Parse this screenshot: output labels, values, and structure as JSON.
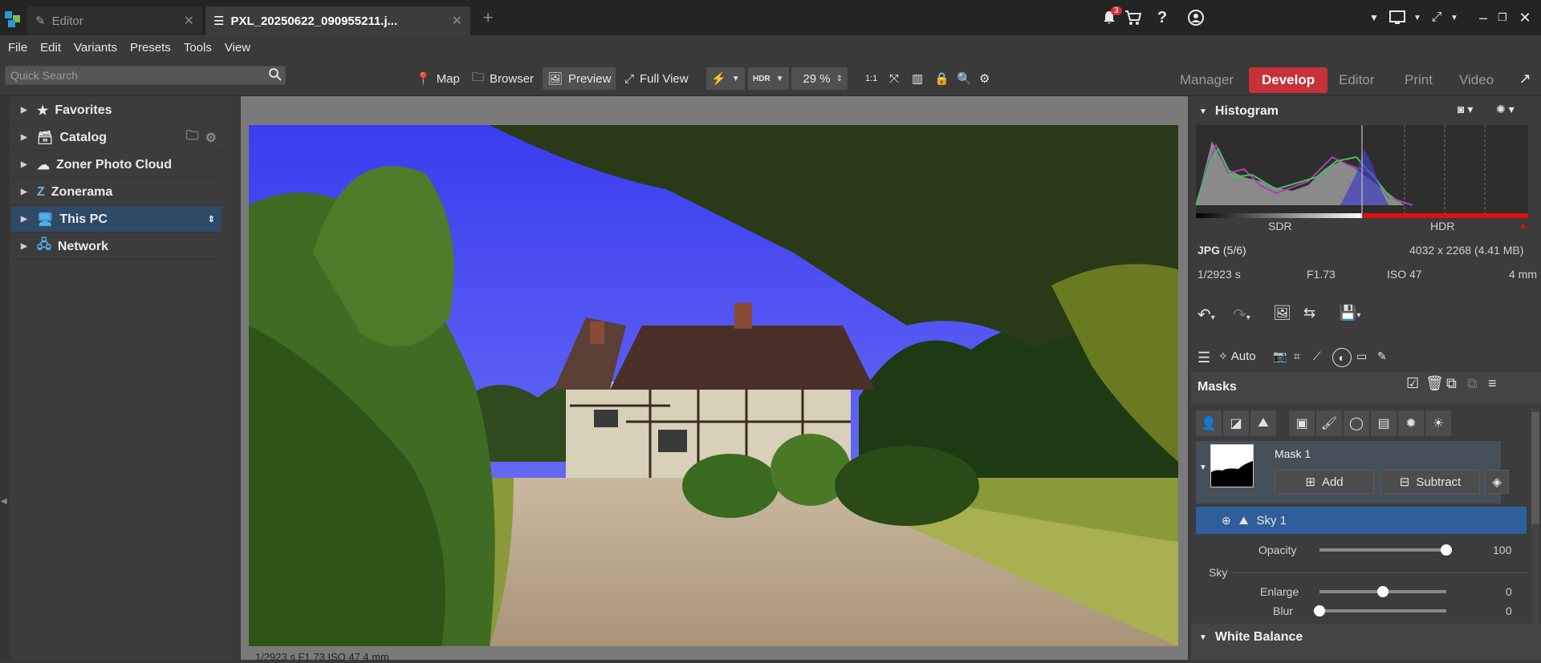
{
  "tabs": [
    {
      "label": "Editor",
      "active": false
    },
    {
      "label": "PXL_20250622_090955211.j...",
      "active": true
    }
  ],
  "notifications": {
    "count": "3"
  },
  "menu": [
    "File",
    "Edit",
    "Variants",
    "Presets",
    "Tools",
    "View"
  ],
  "search": {
    "placeholder": "Quick Search"
  },
  "toolbar": {
    "map": "Map",
    "browser": "Browser",
    "preview": "Preview",
    "fullview": "Full View",
    "hdr": "HDR",
    "zoom": "29 %"
  },
  "modes": [
    "Manager",
    "Develop",
    "Editor",
    "Print",
    "Video"
  ],
  "active_mode": "Develop",
  "nav": [
    {
      "label": "Favorites"
    },
    {
      "label": "Catalog"
    },
    {
      "label": "Zoner Photo Cloud"
    },
    {
      "label": "Zonerama"
    },
    {
      "label": "This PC"
    },
    {
      "label": "Network"
    }
  ],
  "photo_info_bottom": "1/2923 s   F1.73   ISO 47   4 mm",
  "histogram": {
    "title": "Histogram",
    "sdr": "SDR",
    "hdr": "HDR"
  },
  "file_info": {
    "format": "JPG",
    "index": "(5/6)",
    "dims": "4032 x 2268 (4.41 MB)",
    "shutter": "1/2923 s",
    "aperture": "F1.73",
    "iso": "ISO 47",
    "focal": "4 mm"
  },
  "auto_label": "Auto",
  "masks": {
    "title": "Masks",
    "mask_name": "Mask 1",
    "add": "Add",
    "subtract": "Subtract",
    "sky_item": "Sky 1",
    "opacity_label": "Opacity",
    "opacity_value": "100",
    "sky_section": "Sky",
    "enlarge_label": "Enlarge",
    "enlarge_value": "0",
    "blur_label": "Blur",
    "blur_value": "0"
  },
  "opacity_level": 1.0,
  "enlarge_level": 0.5,
  "blur_level": 0.0,
  "white_balance": "White Balance",
  "colors": {
    "accent_red": "#c8303a",
    "selected_blue": "#2f5f9a",
    "nav_selected": "#2f4a66"
  }
}
